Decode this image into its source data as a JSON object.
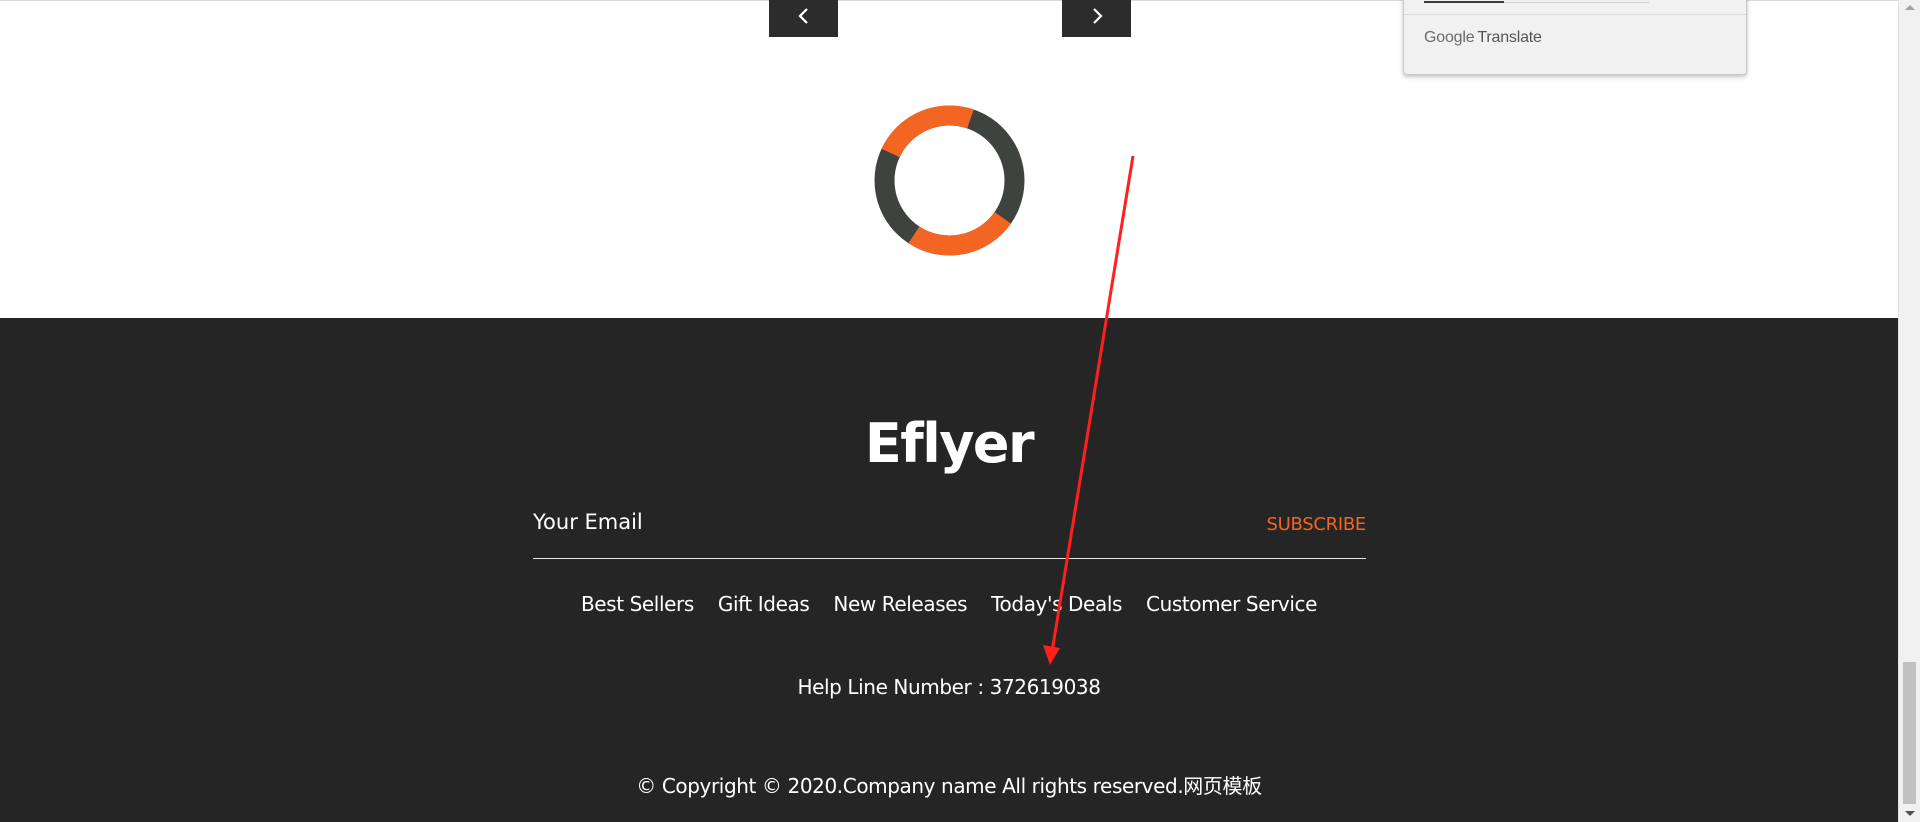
{
  "slider": {
    "prev_icon": "chevron-left-icon",
    "next_icon": "chevron-right-icon"
  },
  "loader": {
    "icon": "loading-spinner-icon",
    "colors": {
      "accent": "#f26522",
      "track": "#3f4340"
    }
  },
  "google_translate": {
    "brand_google": "Google",
    "brand_translate": "Translate"
  },
  "footer": {
    "logo": "Eflyer",
    "email_placeholder": "Your Email",
    "subscribe_label": "SUBSCRIBE",
    "nav": [
      {
        "label": "Best Sellers"
      },
      {
        "label": "Gift Ideas"
      },
      {
        "label": "New Releases"
      },
      {
        "label": "Today's Deals"
      },
      {
        "label": "Customer Service"
      }
    ],
    "helpline": "Help Line Number : 372619038",
    "copyright": "© Copyright © 2020.Company name All rights reserved.网页模板",
    "colors": {
      "background": "#252525",
      "accent": "#f26522",
      "text": "#ffffff"
    }
  },
  "annotation": {
    "type": "red-arrow",
    "color": "#ff1f1f"
  }
}
